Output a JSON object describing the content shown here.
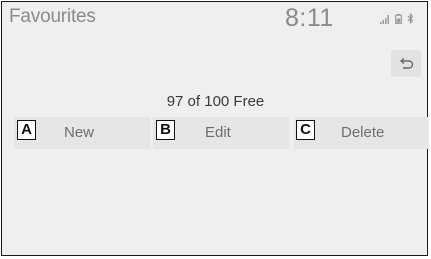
{
  "header": {
    "title": "Favourites",
    "clock": "8:11"
  },
  "status_icons": [
    "signal-strength-icon",
    "battery-icon",
    "bluetooth-icon"
  ],
  "back_icon": "return-arrow-icon",
  "favourites": {
    "free_count": "97 of 100 Free"
  },
  "buttons": [
    {
      "label": "New",
      "callout": "A"
    },
    {
      "label": "Edit",
      "callout": "B"
    },
    {
      "label": "Delete",
      "callout": "C"
    }
  ],
  "colors": {
    "background": "#efefef",
    "button": "#e6e6e6",
    "muted_text": "#8a8a8a"
  }
}
